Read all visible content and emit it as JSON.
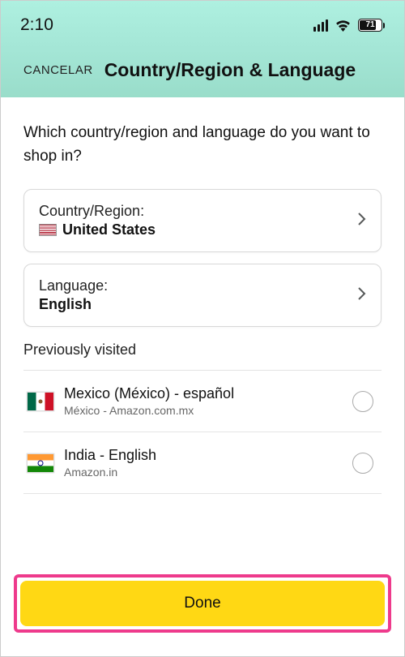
{
  "status": {
    "time": "2:10",
    "battery_pct": "71"
  },
  "header": {
    "cancel": "CANCELAR",
    "title": "Country/Region & Language"
  },
  "prompt": "Which country/region and language do you want to shop in?",
  "country_card": {
    "label": "Country/Region:",
    "value": "United States",
    "flag": "us"
  },
  "language_card": {
    "label": "Language:",
    "value": "English"
  },
  "previously_visited_title": "Previously visited",
  "previously_visited": [
    {
      "flag": "mx",
      "name": "Mexico (México) - español",
      "sub": "México - Amazon.com.mx"
    },
    {
      "flag": "in",
      "name": "India - English",
      "sub": "Amazon.in"
    }
  ],
  "done_label": "Done"
}
